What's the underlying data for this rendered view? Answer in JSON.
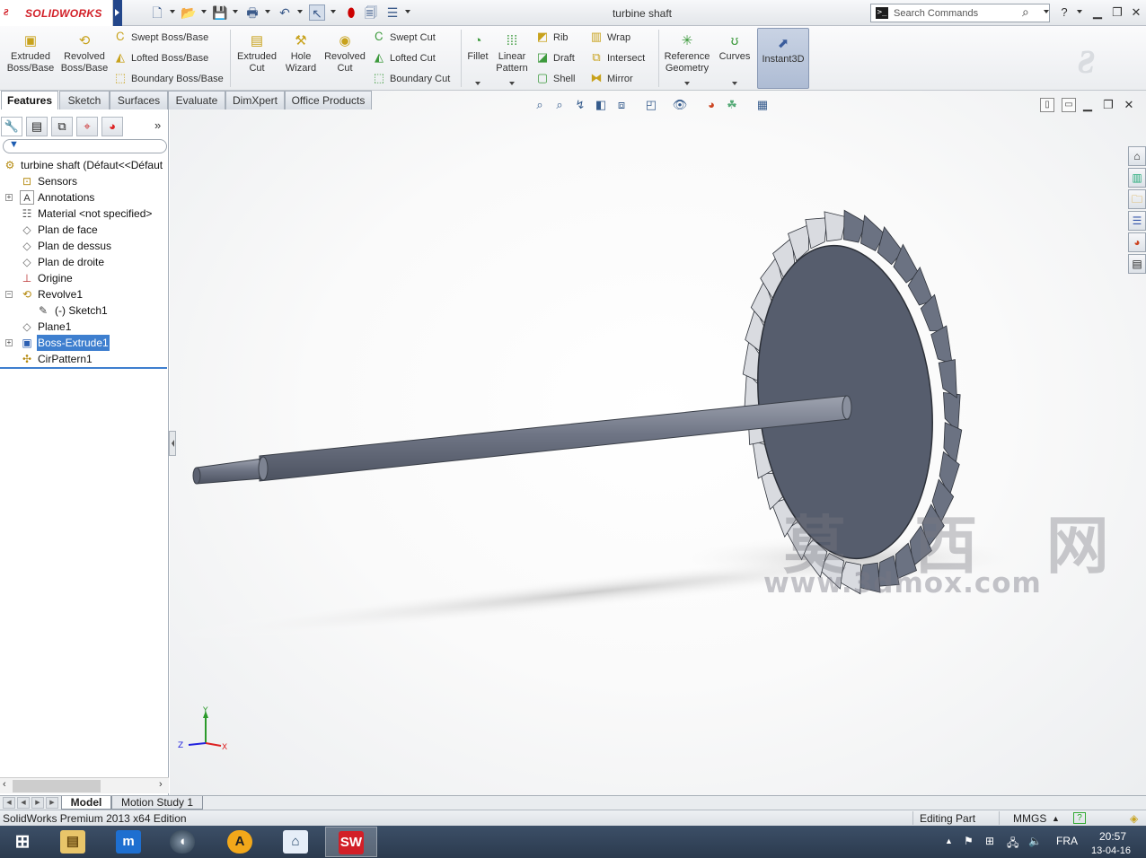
{
  "app": {
    "brand": "SOLIDWORKS",
    "document_title": "turbine shaft",
    "search_placeholder": "Search Commands"
  },
  "command_manager": {
    "extruded_boss": "Extruded Boss/Base",
    "revolved_boss": "Revolved Boss/Base",
    "swept_boss": "Swept Boss/Base",
    "lofted_boss": "Lofted Boss/Base",
    "boundary_boss": "Boundary Boss/Base",
    "extruded_cut": "Extruded Cut",
    "hole_wizard": "Hole Wizard",
    "revolved_cut": "Revolved Cut",
    "swept_cut": "Swept Cut",
    "lofted_cut": "Lofted Cut",
    "boundary_cut": "Boundary Cut",
    "fillet": "Fillet",
    "linear_pattern": "Linear Pattern",
    "rib": "Rib",
    "draft": "Draft",
    "shell": "Shell",
    "wrap": "Wrap",
    "intersect": "Intersect",
    "mirror": "Mirror",
    "reference_geometry": "Reference Geometry",
    "curves": "Curves",
    "instant3d": "Instant3D"
  },
  "tabs": [
    "Features",
    "Sketch",
    "Surfaces",
    "Evaluate",
    "DimXpert",
    "Office Products"
  ],
  "feature_tree": [
    {
      "label": "turbine shaft  (Défaut<<Défaut",
      "icon": "part-icon"
    },
    {
      "label": "Sensors",
      "icon": "sensors-icon"
    },
    {
      "label": "Annotations",
      "icon": "annotations-icon"
    },
    {
      "label": "Material <not specified>",
      "icon": "material-icon"
    },
    {
      "label": "Plan de face",
      "icon": "plane-icon"
    },
    {
      "label": "Plan de dessus",
      "icon": "plane-icon"
    },
    {
      "label": "Plan de droite",
      "icon": "plane-icon"
    },
    {
      "label": "Origine",
      "icon": "origin-icon"
    },
    {
      "label": "Revolve1",
      "icon": "revolve-icon"
    },
    {
      "label": "(-) Sketch1",
      "icon": "sketch-icon"
    },
    {
      "label": "Plane1",
      "icon": "plane-icon"
    },
    {
      "label": "Boss-Extrude1",
      "icon": "extrude-icon"
    },
    {
      "label": "CirPattern1",
      "icon": "circular-pattern-icon"
    }
  ],
  "bottom_tabs": [
    "Model",
    "Motion Study 1"
  ],
  "status": {
    "edition": "SolidWorks Premium 2013 x64 Edition",
    "mode": "Editing Part",
    "units": "MMGS"
  },
  "triad": {
    "x": "X",
    "y": "Y",
    "z": "Z"
  },
  "watermark": {
    "cn": "莫 西 网",
    "url": "www.3dmox.com"
  },
  "taskbar": {
    "language": "FRA",
    "time": "20:57",
    "date": "13-04-16"
  },
  "colors": {
    "brand_red": "#d21f27",
    "selection_blue": "#3e7fcf",
    "model_gray": "#565d6d",
    "taskbar": "#2f3f55"
  }
}
